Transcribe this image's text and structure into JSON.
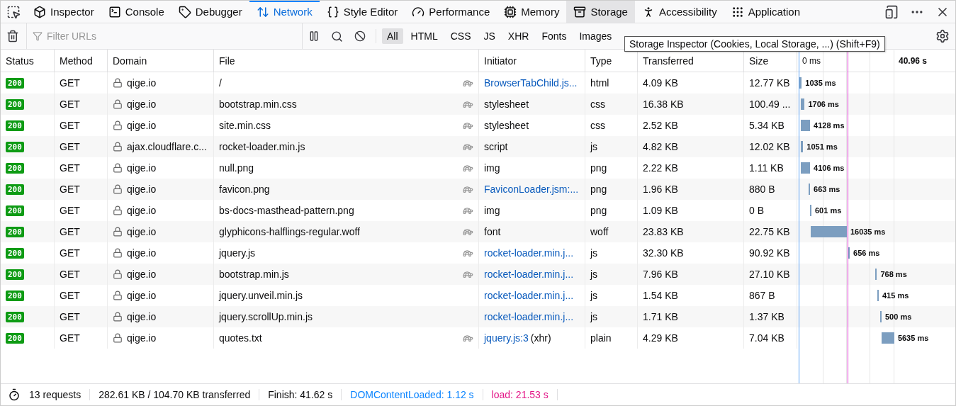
{
  "tabs": [
    {
      "kind": "inspector",
      "label": "Inspector",
      "selected": false,
      "hovered": false
    },
    {
      "kind": "console",
      "label": "Console",
      "selected": false,
      "hovered": false
    },
    {
      "kind": "debugger",
      "label": "Debugger",
      "selected": false,
      "hovered": false
    },
    {
      "kind": "network",
      "label": "Network",
      "selected": true,
      "hovered": false
    },
    {
      "kind": "style",
      "label": "Style Editor",
      "selected": false,
      "hovered": false
    },
    {
      "kind": "performance",
      "label": "Performance",
      "selected": false,
      "hovered": false
    },
    {
      "kind": "memory",
      "label": "Memory",
      "selected": false,
      "hovered": false
    },
    {
      "kind": "storage",
      "label": "Storage",
      "selected": false,
      "hovered": true
    },
    {
      "kind": "accessibility",
      "label": "Accessibility",
      "selected": false,
      "hovered": false
    },
    {
      "kind": "application",
      "label": "Application",
      "selected": false,
      "hovered": false
    }
  ],
  "filter": {
    "placeholder": "Filter URLs"
  },
  "type_filters": [
    {
      "label": "All",
      "selected": true
    },
    {
      "label": "HTML",
      "selected": false
    },
    {
      "label": "CSS",
      "selected": false
    },
    {
      "label": "JS",
      "selected": false
    },
    {
      "label": "XHR",
      "selected": false
    },
    {
      "label": "Fonts",
      "selected": false
    },
    {
      "label": "Images",
      "selected": false
    }
  ],
  "tooltip": "Storage Inspector (Cookies, Local Storage, ...) (Shift+F9)",
  "columns": [
    "Status",
    "Method",
    "Domain",
    "File",
    "Initiator",
    "Type",
    "Transferred",
    "Size"
  ],
  "timeline": {
    "start_label": "0 ms",
    "end_label": "40.96 s"
  },
  "rows": [
    {
      "status": "200",
      "method": "GET",
      "domain": "qige.io",
      "file": "/",
      "throttled": true,
      "initiator": "BrowserTabChild.js...",
      "initiator_link": true,
      "type": "html",
      "transferred": "4.09 KB",
      "size": "12.77 KB",
      "duration": "1035 ms"
    },
    {
      "status": "200",
      "method": "GET",
      "domain": "qige.io",
      "file": "bootstrap.min.css",
      "throttled": true,
      "initiator": "stylesheet",
      "initiator_link": false,
      "type": "css",
      "transferred": "16.38 KB",
      "size": "100.49 ...",
      "duration": "1706 ms"
    },
    {
      "status": "200",
      "method": "GET",
      "domain": "qige.io",
      "file": "site.min.css",
      "throttled": true,
      "initiator": "stylesheet",
      "initiator_link": false,
      "type": "css",
      "transferred": "2.52 KB",
      "size": "5.34 KB",
      "duration": "4128 ms"
    },
    {
      "status": "200",
      "method": "GET",
      "domain": "ajax.cloudflare.c...",
      "file": "rocket-loader.min.js",
      "throttled": true,
      "initiator": "script",
      "initiator_link": false,
      "type": "js",
      "transferred": "4.82 KB",
      "size": "12.02 KB",
      "duration": "1051 ms"
    },
    {
      "status": "200",
      "method": "GET",
      "domain": "qige.io",
      "file": "null.png",
      "throttled": true,
      "initiator": "img",
      "initiator_link": false,
      "type": "png",
      "transferred": "2.22 KB",
      "size": "1.11 KB",
      "duration": "4106 ms"
    },
    {
      "status": "200",
      "method": "GET",
      "domain": "qige.io",
      "file": "favicon.png",
      "throttled": true,
      "initiator": "FaviconLoader.jsm:...",
      "initiator_link": true,
      "type": "png",
      "transferred": "1.96 KB",
      "size": "880 B",
      "duration": "663 ms"
    },
    {
      "status": "200",
      "method": "GET",
      "domain": "qige.io",
      "file": "bs-docs-masthead-pattern.png",
      "throttled": true,
      "initiator": "img",
      "initiator_link": false,
      "type": "png",
      "transferred": "1.09 KB",
      "size": "0 B",
      "duration": "601 ms"
    },
    {
      "status": "200",
      "method": "GET",
      "domain": "qige.io",
      "file": "glyphicons-halflings-regular.woff",
      "throttled": true,
      "initiator": "font",
      "initiator_link": false,
      "type": "woff",
      "transferred": "23.83 KB",
      "size": "22.75 KB",
      "duration": "16035 ms"
    },
    {
      "status": "200",
      "method": "GET",
      "domain": "qige.io",
      "file": "jquery.js",
      "throttled": true,
      "initiator": "rocket-loader.min.j...",
      "initiator_link": true,
      "type": "js",
      "transferred": "32.30 KB",
      "size": "90.92 KB",
      "duration": "656 ms"
    },
    {
      "status": "200",
      "method": "GET",
      "domain": "qige.io",
      "file": "bootstrap.min.js",
      "throttled": true,
      "initiator": "rocket-loader.min.j...",
      "initiator_link": true,
      "type": "js",
      "transferred": "7.96 KB",
      "size": "27.10 KB",
      "duration": "768 ms"
    },
    {
      "status": "200",
      "method": "GET",
      "domain": "qige.io",
      "file": "jquery.unveil.min.js",
      "throttled": false,
      "initiator": "rocket-loader.min.j...",
      "initiator_link": true,
      "type": "js",
      "transferred": "1.54 KB",
      "size": "867 B",
      "duration": "415 ms"
    },
    {
      "status": "200",
      "method": "GET",
      "domain": "qige.io",
      "file": "jquery.scrollUp.min.js",
      "throttled": false,
      "initiator": "rocket-loader.min.j...",
      "initiator_link": true,
      "type": "js",
      "transferred": "1.71 KB",
      "size": "1.37 KB",
      "duration": "500 ms"
    },
    {
      "status": "200",
      "method": "GET",
      "domain": "qige.io",
      "file": "quotes.txt",
      "throttled": true,
      "initiator": "jquery.js:3",
      "initiator_suffix": "(xhr)",
      "initiator_link": true,
      "type": "plain",
      "transferred": "4.29 KB",
      "size": "7.04 KB",
      "duration": "5635 ms"
    }
  ],
  "status_bar": {
    "requests": "13 requests",
    "transferred": "282.61 KB / 104.70 KB transferred",
    "finish": "Finish: 41.62 s",
    "dom_loaded": "DOMContentLoaded: 1.12 s",
    "load": "load: 21.53 s"
  }
}
